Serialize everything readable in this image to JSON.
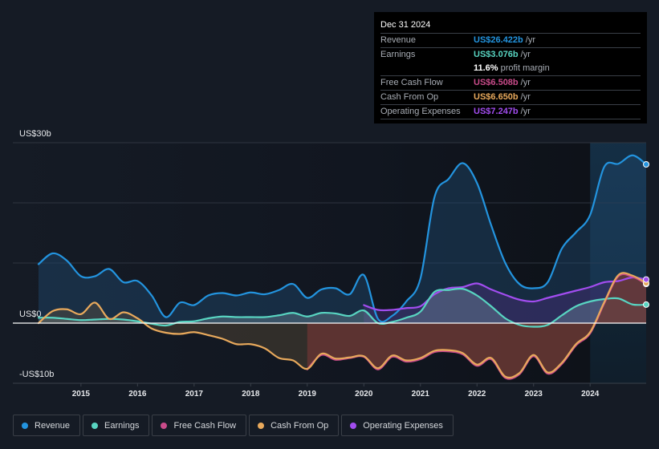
{
  "tooltip": {
    "date": "Dec 31 2024",
    "rows": [
      {
        "label": "Revenue",
        "value": "US$26.422b",
        "unit": "/yr",
        "color": "#2394df"
      },
      {
        "label": "Earnings",
        "value": "US$3.076b",
        "unit": "/yr",
        "color": "#58d4c1"
      },
      {
        "label": "",
        "margin_value": "11.6%",
        "margin_text": "profit margin"
      },
      {
        "label": "Free Cash Flow",
        "value": "US$6.508b",
        "unit": "/yr",
        "color": "#c94b8a"
      },
      {
        "label": "Cash From Op",
        "value": "US$6.650b",
        "unit": "/yr",
        "color": "#e8a95c"
      },
      {
        "label": "Operating Expenses",
        "value": "US$7.247b",
        "unit": "/yr",
        "color": "#a24df0"
      }
    ]
  },
  "legend": [
    {
      "label": "Revenue",
      "color": "#2394df"
    },
    {
      "label": "Earnings",
      "color": "#58d4c1"
    },
    {
      "label": "Free Cash Flow",
      "color": "#c94b8a"
    },
    {
      "label": "Cash From Op",
      "color": "#e8a95c"
    },
    {
      "label": "Operating Expenses",
      "color": "#a24df0"
    }
  ],
  "chart_data": {
    "type": "line",
    "title": "",
    "xlabel": "",
    "ylabel": "",
    "ylim": [
      -10,
      30
    ],
    "xlim": [
      2014.25,
      2025.0
    ],
    "y_ticks": [
      {
        "value": 30,
        "label": "US$30b"
      },
      {
        "value": 0,
        "label": "US$0"
      },
      {
        "value": -10,
        "label": "-US$10b"
      }
    ],
    "y_gridlines": [
      30,
      20,
      10,
      0,
      -10
    ],
    "x_ticks": [
      {
        "value": 2015,
        "label": "2015"
      },
      {
        "value": 2016,
        "label": "2016"
      },
      {
        "value": 2017,
        "label": "2017"
      },
      {
        "value": 2018,
        "label": "2018"
      },
      {
        "value": 2019,
        "label": "2019"
      },
      {
        "value": 2020,
        "label": "2020"
      },
      {
        "value": 2021,
        "label": "2021"
      },
      {
        "value": 2022,
        "label": "2022"
      },
      {
        "value": 2023,
        "label": "2023"
      },
      {
        "value": 2024,
        "label": "2024"
      }
    ],
    "highlight_from": 2024.0,
    "legend_position": "bottom-left",
    "series": [
      {
        "name": "Revenue",
        "color": "#2394df",
        "x": [
          2014.25,
          2014.5,
          2014.75,
          2015.0,
          2015.25,
          2015.5,
          2015.75,
          2016.0,
          2016.25,
          2016.5,
          2016.75,
          2017.0,
          2017.25,
          2017.5,
          2017.75,
          2018.0,
          2018.25,
          2018.5,
          2018.75,
          2019.0,
          2019.25,
          2019.5,
          2019.75,
          2020.0,
          2020.25,
          2020.5,
          2020.75,
          2021.0,
          2021.25,
          2021.5,
          2021.75,
          2022.0,
          2022.25,
          2022.5,
          2022.75,
          2023.0,
          2023.25,
          2023.5,
          2023.75,
          2024.0,
          2024.25,
          2024.5,
          2024.75,
          2024.99
        ],
        "values": [
          9.8,
          11.6,
          10.4,
          7.8,
          7.8,
          9.0,
          6.8,
          7.0,
          4.6,
          1.0,
          3.4,
          3.0,
          4.6,
          5.0,
          4.6,
          5.1,
          4.8,
          5.5,
          6.5,
          4.2,
          5.6,
          5.8,
          4.8,
          8.0,
          0.7,
          1.2,
          3.6,
          7.4,
          21.0,
          24.0,
          26.6,
          23.3,
          16.3,
          10.0,
          6.5,
          5.8,
          6.8,
          12.4,
          15.1,
          18.0,
          26.0,
          26.5,
          27.9,
          26.4
        ]
      },
      {
        "name": "Earnings",
        "color": "#58d4c1",
        "x": [
          2014.25,
          2014.5,
          2014.75,
          2015.0,
          2015.25,
          2015.5,
          2015.75,
          2016.0,
          2016.25,
          2016.5,
          2016.75,
          2017.0,
          2017.25,
          2017.5,
          2017.75,
          2018.0,
          2018.25,
          2018.5,
          2018.75,
          2019.0,
          2019.25,
          2019.5,
          2019.75,
          2020.0,
          2020.25,
          2020.5,
          2020.75,
          2021.0,
          2021.25,
          2021.5,
          2021.75,
          2022.0,
          2022.25,
          2022.5,
          2022.75,
          2023.0,
          2023.25,
          2023.5,
          2023.75,
          2024.0,
          2024.25,
          2024.5,
          2024.75,
          2024.99
        ],
        "values": [
          0.9,
          0.9,
          0.7,
          0.5,
          0.6,
          0.7,
          0.6,
          0.3,
          -0.1,
          -0.4,
          0.2,
          0.3,
          0.8,
          1.1,
          1.0,
          1.0,
          1.0,
          1.3,
          1.7,
          1.1,
          1.7,
          1.6,
          1.2,
          2.1,
          0.0,
          0.2,
          0.9,
          1.9,
          5.2,
          5.5,
          5.7,
          4.6,
          2.8,
          0.8,
          -0.3,
          -0.6,
          -0.3,
          1.3,
          2.8,
          3.6,
          4.0,
          4.1,
          3.1,
          3.08
        ]
      },
      {
        "name": "Free Cash Flow",
        "color": "#c94b8a",
        "x": [
          2019.0,
          2019.25,
          2019.5,
          2019.75,
          2020.0,
          2020.25,
          2020.5,
          2020.75,
          2021.0,
          2021.25,
          2021.5,
          2021.75,
          2022.0,
          2022.25,
          2022.5,
          2022.75,
          2023.0,
          2023.25,
          2023.5,
          2023.75,
          2024.0,
          2024.25,
          2024.5,
          2024.75,
          2024.99
        ],
        "values": [
          -7.7,
          -5.3,
          -6.1,
          -5.8,
          -5.6,
          -7.7,
          -5.6,
          -6.4,
          -6.0,
          -4.8,
          -4.7,
          -5.2,
          -7.1,
          -6.0,
          -9.1,
          -8.5,
          -5.5,
          -8.4,
          -6.8,
          -3.7,
          -1.7,
          3.3,
          7.8,
          7.7,
          6.51
        ]
      },
      {
        "name": "Cash From Op",
        "color": "#e8a95c",
        "x": [
          2014.25,
          2014.5,
          2014.75,
          2015.0,
          2015.25,
          2015.5,
          2015.75,
          2016.0,
          2016.25,
          2016.5,
          2016.75,
          2017.0,
          2017.25,
          2017.5,
          2017.75,
          2018.0,
          2018.25,
          2018.5,
          2018.75,
          2019.0,
          2019.25,
          2019.5,
          2019.75,
          2020.0,
          2020.25,
          2020.5,
          2020.75,
          2021.0,
          2021.25,
          2021.5,
          2021.75,
          2022.0,
          2022.25,
          2022.5,
          2022.75,
          2023.0,
          2023.25,
          2023.5,
          2023.75,
          2024.0,
          2024.25,
          2024.5,
          2024.75,
          2024.99
        ],
        "values": [
          0.0,
          2.0,
          2.3,
          1.5,
          3.4,
          0.7,
          1.8,
          0.8,
          -0.9,
          -1.6,
          -1.8,
          -1.5,
          -2.0,
          -2.6,
          -3.5,
          -3.5,
          -4.2,
          -5.8,
          -6.2,
          -7.6,
          -5.1,
          -5.9,
          -5.7,
          -5.5,
          -7.5,
          -5.4,
          -6.2,
          -5.8,
          -4.6,
          -4.5,
          -5.0,
          -6.9,
          -5.8,
          -8.9,
          -8.3,
          -5.3,
          -8.2,
          -6.6,
          -3.5,
          -1.5,
          3.5,
          8.0,
          7.9,
          6.65
        ]
      },
      {
        "name": "Operating Expenses",
        "color": "#a24df0",
        "x": [
          2020.0,
          2020.25,
          2020.5,
          2020.75,
          2021.0,
          2021.25,
          2021.5,
          2021.75,
          2022.0,
          2022.25,
          2022.5,
          2022.75,
          2023.0,
          2023.25,
          2023.5,
          2023.75,
          2024.0,
          2024.25,
          2024.5,
          2024.75,
          2024.99
        ],
        "values": [
          3.0,
          2.2,
          2.2,
          2.5,
          2.8,
          4.8,
          5.8,
          6.0,
          6.6,
          5.6,
          4.7,
          3.9,
          3.6,
          4.2,
          4.8,
          5.4,
          6.0,
          6.8,
          7.0,
          7.6,
          7.25
        ]
      }
    ]
  }
}
